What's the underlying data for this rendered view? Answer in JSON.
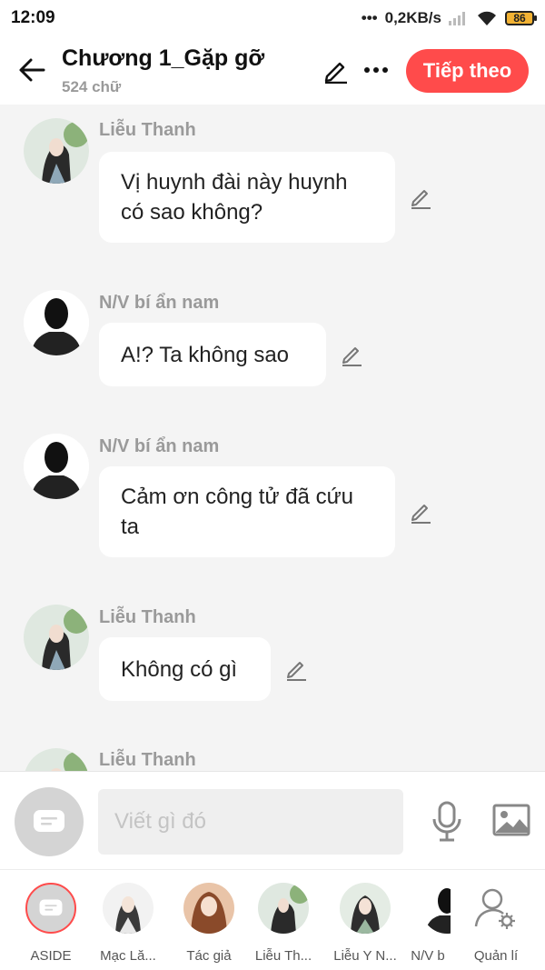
{
  "status_bar": {
    "time": "12:09",
    "speed": "0,2KB/s",
    "battery": "86"
  },
  "header": {
    "title": "Chương 1_Gặp gỡ",
    "word_count": "524 chữ",
    "next_label": "Tiếp theo"
  },
  "messages": [
    {
      "sender": "Liễu Thanh",
      "text": "Vị huynh đài này huynh có sao không?"
    },
    {
      "sender": "N/V bí ẩn nam",
      "text": "A!? Ta không sao"
    },
    {
      "sender": "N/V bí ẩn nam",
      "text": "Cảm ơn công tử đã cứu ta"
    },
    {
      "sender": "Liễu Thanh",
      "text": "Không có gì"
    },
    {
      "sender": "Liễu Thanh",
      "text": ""
    }
  ],
  "input": {
    "placeholder": "Viết gì đó"
  },
  "characters": [
    {
      "label": "ASIDE"
    },
    {
      "label": "Mạc Lă..."
    },
    {
      "label": "Tác giả"
    },
    {
      "label": "Liễu Th..."
    },
    {
      "label": "Liễu Y N..."
    },
    {
      "label": "N/V b"
    },
    {
      "label": "Quản lí"
    }
  ],
  "colors": {
    "accent": "#ff4b4b",
    "bubble": "#ffffff",
    "background": "#f4f4f4"
  }
}
